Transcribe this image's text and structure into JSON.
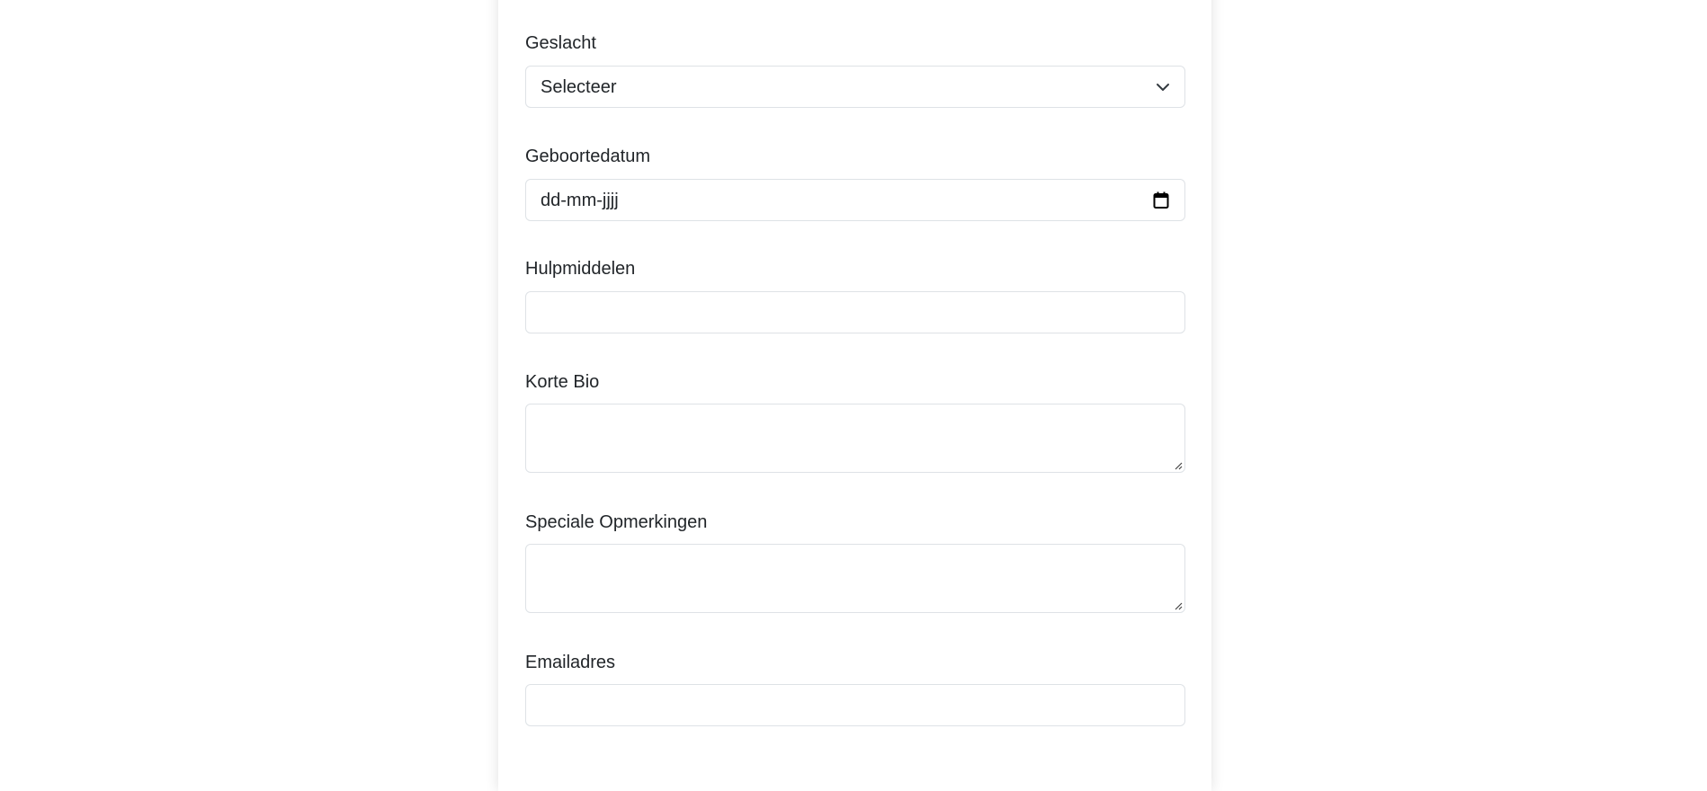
{
  "form": {
    "gender": {
      "label": "Geslacht",
      "selected": "Selecteer"
    },
    "birthdate": {
      "label": "Geboortedatum",
      "placeholder": "dd-mm-jjjj"
    },
    "aids": {
      "label": "Hulpmiddelen",
      "value": ""
    },
    "bio": {
      "label": "Korte Bio",
      "value": ""
    },
    "remarks": {
      "label": "Speciale Opmerkingen",
      "value": ""
    },
    "email": {
      "label": "Emailadres",
      "value": ""
    }
  },
  "icons": {
    "select": "chevron-down-icon",
    "date": "calendar-icon",
    "textarea": "resize-handle-icon"
  },
  "colors": {
    "border": "#dee2e6",
    "text": "#212529",
    "background": "#ffffff"
  }
}
